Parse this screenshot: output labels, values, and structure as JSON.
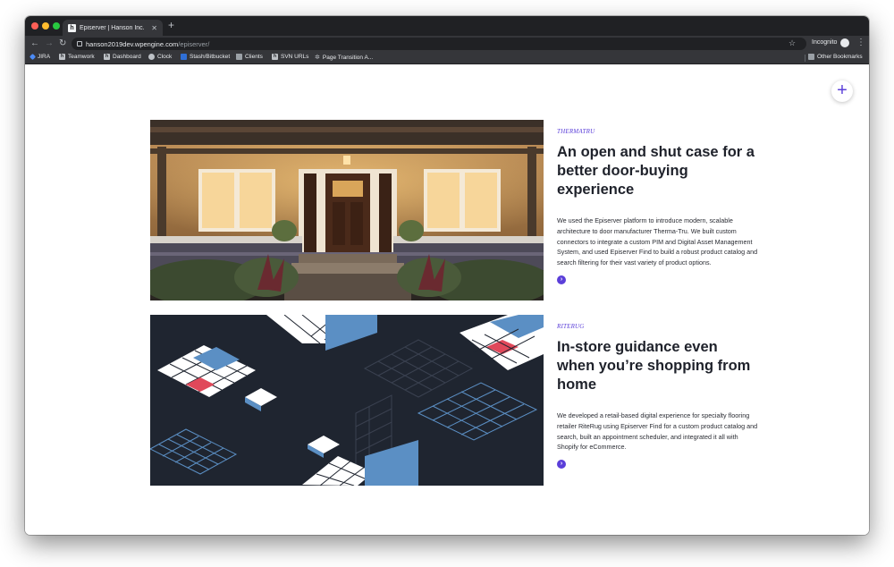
{
  "browser": {
    "tab_title": "Episerver | Hanson Inc.",
    "tab_favicon": "h",
    "new_tab_label": "+",
    "url_domain": "hanson2019dev.wpengine.com",
    "url_path": "/episerver/",
    "incognito_label": "Incognito",
    "bookmarks": [
      {
        "label": "JIRA",
        "icon": "jira-icon"
      },
      {
        "label": "Teamwork",
        "icon": "h"
      },
      {
        "label": "Dashboard",
        "icon": "h"
      },
      {
        "label": "Clock",
        "icon": "clock-icon"
      },
      {
        "label": "Stash/Bitbucket",
        "icon": "bitbucket-icon"
      },
      {
        "label": "Clients",
        "icon": "folder-icon"
      },
      {
        "label": "SVN URLs",
        "icon": "h"
      },
      {
        "label": "Page Transition A...",
        "icon": "gear-icon"
      }
    ],
    "other_bookmarks": "Other Bookmarks"
  },
  "page": {
    "accent_color": "#5b3fd9",
    "plus_label": "+",
    "cases": [
      {
        "eyebrow": "THERMATRU",
        "title": "An open and shut case for a better door-buying experience",
        "body": "We used the Episerver platform to introduce modern, scalable architecture to door manufacturer Therma-Tru. We built custom connectors to integrate a custom PIM and Digital Asset Management System, and used Episerver Find to build a robust product catalog and search filtering for their vast variety of product options.",
        "arrow": "›"
      },
      {
        "eyebrow": "RITERUG",
        "title": "In-store guidance even when you’re shopping from home",
        "body": "We developed a retail-based digital experience for specialty flooring retailer RiteRug using Episerver Find for a custom product catalog and search, built an appointment scheduler, and integrated it all with Shopify for eCommerce.",
        "arrow": "›"
      }
    ]
  }
}
